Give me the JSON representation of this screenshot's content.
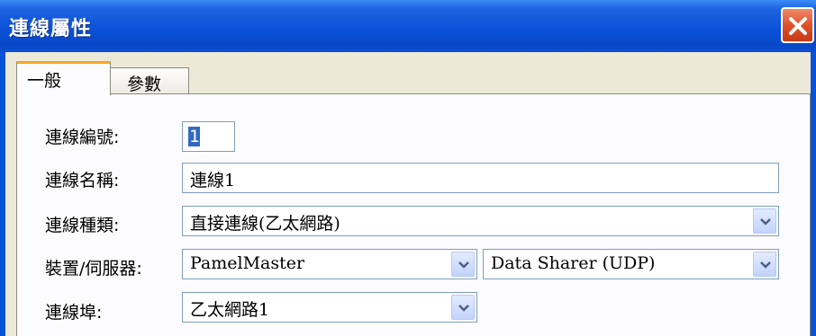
{
  "window": {
    "title": "連線屬性"
  },
  "tabs": [
    {
      "label": "一般",
      "active": true
    },
    {
      "label": "參數",
      "active": false
    }
  ],
  "form": {
    "conn_id": {
      "label": "連線編號:",
      "value": "1"
    },
    "conn_name": {
      "label": "連線名稱:",
      "value": "連線1"
    },
    "conn_type": {
      "label": "連線種類:",
      "value": "直接連線(乙太網路)"
    },
    "device": {
      "label": "裝置/伺服器:",
      "device_value": "PamelMaster",
      "server_value": "Data Sharer (UDP)"
    },
    "port": {
      "label": "連線埠:",
      "value": "乙太網路1"
    }
  },
  "icons": {
    "close": "close-icon",
    "dropdown": "chevron-down-icon"
  },
  "colors": {
    "titlebar": "#0a52d8",
    "close_button": "#e0502a",
    "selection": "#316ac5"
  }
}
